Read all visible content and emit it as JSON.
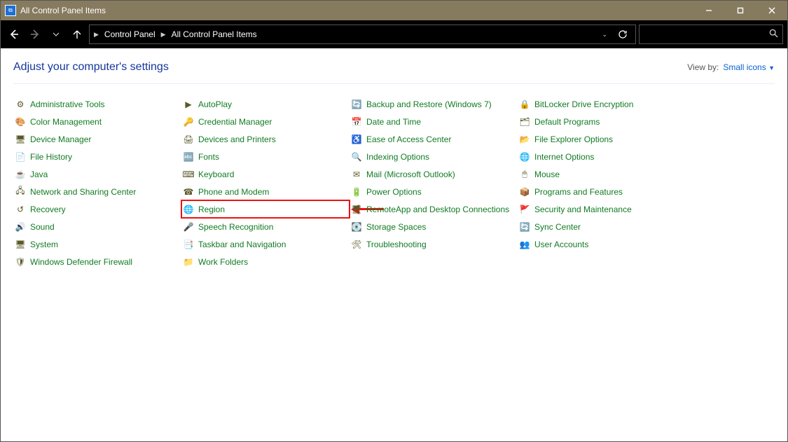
{
  "window": {
    "title": "All Control Panel Items"
  },
  "breadcrumb": {
    "root": "Control Panel",
    "current": "All Control Panel Items"
  },
  "page": {
    "heading": "Adjust your computer's settings",
    "viewby_label": "View by:",
    "viewby_value": "Small icons"
  },
  "items": {
    "c1": [
      {
        "icon": "⚙",
        "label": "Administrative Tools"
      },
      {
        "icon": "🎨",
        "label": "Color Management"
      },
      {
        "icon": "🖥",
        "label": "Device Manager"
      },
      {
        "icon": "📄",
        "label": "File History"
      },
      {
        "icon": "☕",
        "label": "Java"
      },
      {
        "icon": "🖧",
        "label": "Network and Sharing Center"
      },
      {
        "icon": "↺",
        "label": "Recovery"
      },
      {
        "icon": "🔊",
        "label": "Sound"
      },
      {
        "icon": "🖥",
        "label": "System"
      },
      {
        "icon": "🛡",
        "label": "Windows Defender Firewall"
      }
    ],
    "c2": [
      {
        "icon": "▶",
        "label": "AutoPlay"
      },
      {
        "icon": "🔑",
        "label": "Credential Manager"
      },
      {
        "icon": "🖨",
        "label": "Devices and Printers"
      },
      {
        "icon": "🔤",
        "label": "Fonts"
      },
      {
        "icon": "⌨",
        "label": "Keyboard"
      },
      {
        "icon": "☎",
        "label": "Phone and Modem"
      },
      {
        "icon": "🌐",
        "label": "Region",
        "highlight": true
      },
      {
        "icon": "🎤",
        "label": "Speech Recognition"
      },
      {
        "icon": "📑",
        "label": "Taskbar and Navigation"
      },
      {
        "icon": "📁",
        "label": "Work Folders"
      }
    ],
    "c3": [
      {
        "icon": "🔄",
        "label": "Backup and Restore (Windows 7)"
      },
      {
        "icon": "📅",
        "label": "Date and Time"
      },
      {
        "icon": "♿",
        "label": "Ease of Access Center"
      },
      {
        "icon": "🔍",
        "label": "Indexing Options"
      },
      {
        "icon": "✉",
        "label": "Mail (Microsoft Outlook)"
      },
      {
        "icon": "🔋",
        "label": "Power Options"
      },
      {
        "icon": "🖥",
        "label": "RemoteApp and Desktop Connections"
      },
      {
        "icon": "💽",
        "label": "Storage Spaces"
      },
      {
        "icon": "🛠",
        "label": "Troubleshooting"
      }
    ],
    "c4": [
      {
        "icon": "🔒",
        "label": "BitLocker Drive Encryption"
      },
      {
        "icon": "🗂",
        "label": "Default Programs"
      },
      {
        "icon": "📂",
        "label": "File Explorer Options"
      },
      {
        "icon": "🌐",
        "label": "Internet Options"
      },
      {
        "icon": "🖱",
        "label": "Mouse"
      },
      {
        "icon": "📦",
        "label": "Programs and Features"
      },
      {
        "icon": "🚩",
        "label": "Security and Maintenance"
      },
      {
        "icon": "🔄",
        "label": "Sync Center"
      },
      {
        "icon": "👥",
        "label": "User Accounts"
      }
    ]
  }
}
